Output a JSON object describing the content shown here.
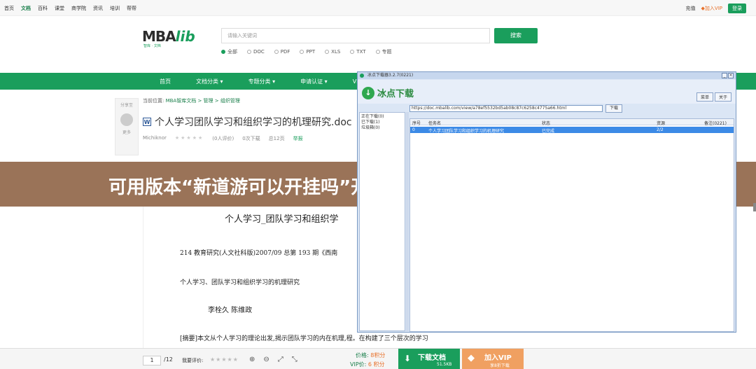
{
  "topnav": {
    "items": [
      "首页",
      "文档",
      "百科",
      "课堂",
      "商学院",
      "资讯",
      "培训",
      "帮帮"
    ],
    "active_index": 1
  },
  "topright": {
    "recharge": "充值",
    "vip": "加入VIP",
    "login": "登录"
  },
  "logo": {
    "main": "MBA",
    "accent": "lib",
    "sub": "智库 · 文档"
  },
  "search": {
    "placeholder": "请输入关键词",
    "button": "搜索"
  },
  "filters": [
    "全部",
    "DOC",
    "PDF",
    "PPT",
    "XLS",
    "TXT",
    "专题"
  ],
  "navbar": {
    "items": [
      "首页",
      "文档分类 ▾",
      "专题分类 ▾",
      "申请认证 ▾",
      "VIP免"
    ]
  },
  "sidebar": {
    "title": "分享至",
    "more": "更多"
  },
  "breadcrumb": {
    "prefix": "当前位置:",
    "path": "MBA智库文档 > 管理 > 组织管理"
  },
  "doc": {
    "title": "个人学习团队学习和组织学习的机理研究.doc",
    "author": "Michiknor",
    "rating_count": "(0人评价)",
    "downloads": "0次下载",
    "pages": "总12页",
    "report": "举报",
    "heading": "个人学习_团队学习和组织学",
    "line1": "214   教育研究(人文社科版)2007/09 总第 193 期《西南",
    "line2": "个人学习、团队学习和组织学习的机理研究",
    "line3": "李栓久   陈维政",
    "line4": "[摘要]本文从个人学习的理论出发,揭示团队学习的内在机理,程。在构建了三个层次的学习"
  },
  "banner": {
    "text": "可用版本“新道游可以开挂吗”开挂(透视)辅助神器"
  },
  "bottom": {
    "page_current": "1",
    "page_total": "/12",
    "rate_label": "我要评价:",
    "price_label": "价格:",
    "price_value": "8积分",
    "vip_price_label": "VIP价:",
    "vip_price_value": "6 积分",
    "download_label": "下载文档",
    "download_size": "51.5KB",
    "vip_label": "加入VIP",
    "vip_sub": "享8折下载"
  },
  "app": {
    "title": "冰点下载器3.2.7(0221)",
    "name": "冰点下载",
    "menu_btn": "菜单",
    "about_btn": "关于",
    "url": "https://doc.mbalib.com/view/a78ef5532bd5ab08c87c6258c4775a66.html",
    "download_btn": "下载",
    "left_items": [
      "正在下载(0)",
      "已下载(1)",
      "垃圾箱(0)"
    ],
    "columns": [
      "序号",
      "任务名",
      "状态",
      "资源",
      "备注(0221)"
    ],
    "rows": [
      {
        "no": "0",
        "name": "个人学习团队学习和组织学习的机理研究",
        "status": "已完成",
        "res": "2/2",
        "note": ""
      }
    ]
  },
  "colors": {
    "brand": "#1a9e5c",
    "banner": "#9a7358",
    "vip": "#f0a061"
  }
}
